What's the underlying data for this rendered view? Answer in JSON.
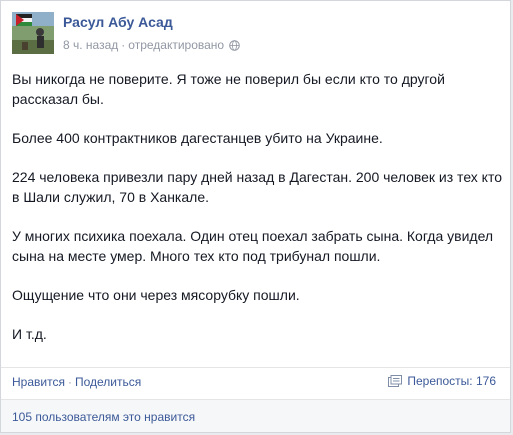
{
  "post": {
    "author": "Расул Абу Асад",
    "time": "8 ч. назад",
    "separator": "·",
    "edited": "отредактировано",
    "privacy_icon": "globe-icon",
    "paragraphs": [
      "Вы никогда не поверите. Я тоже не поверил бы если кто то другой рассказал бы.",
      "Более 400 контрактников дагестанцев убито на Украине.",
      "224 человека привезли пару дней назад в Дагестан. 200 человек из тех кто в Шали служил, 70 в Ханкале.",
      "У многих психика поехала. Один отец поехал забрать сына. Когда увидел сына на месте умер. Много тех кто под трибунал пошли.",
      "Ощущение что они через мясорубку пошли.",
      "И т.д."
    ]
  },
  "actions": {
    "like_label": "Нравится",
    "dot": "·",
    "share_label": "Поделиться",
    "shares_label": "Перепосты: 176",
    "shares_icon": "repost-icon"
  },
  "likes": {
    "text": "105 пользователям это нравится"
  },
  "colors": {
    "link": "#3b5998",
    "meta": "#9197a3",
    "text": "#141823"
  }
}
